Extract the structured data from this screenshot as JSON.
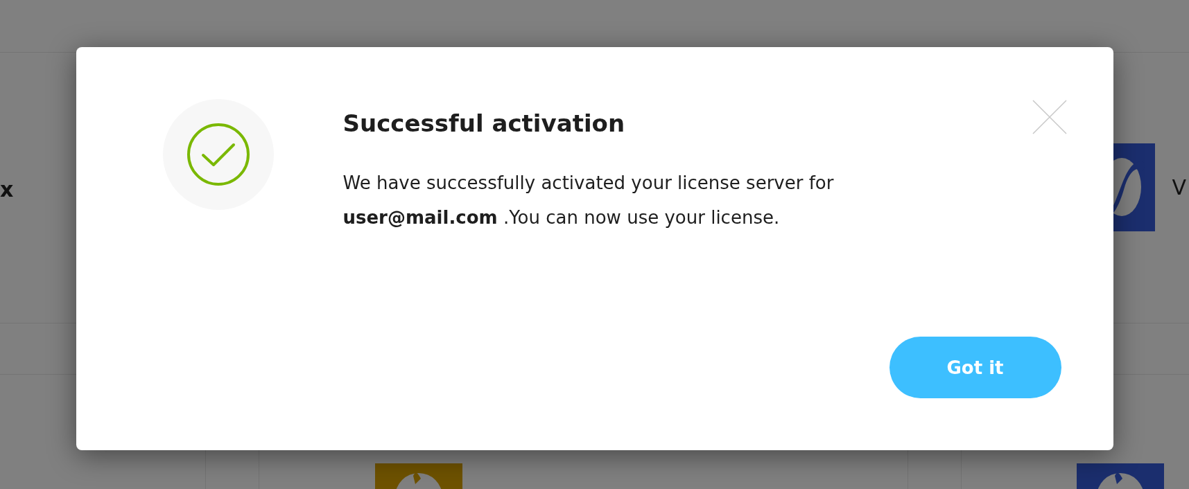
{
  "background": {
    "left_text": "x",
    "right_text": "V"
  },
  "dialog": {
    "title": "Successful activation",
    "message_lines": [
      "We have successfully activated your license server for",
      "**user@mail.com** .You can now use your license."
    ],
    "button": "Got it"
  }
}
